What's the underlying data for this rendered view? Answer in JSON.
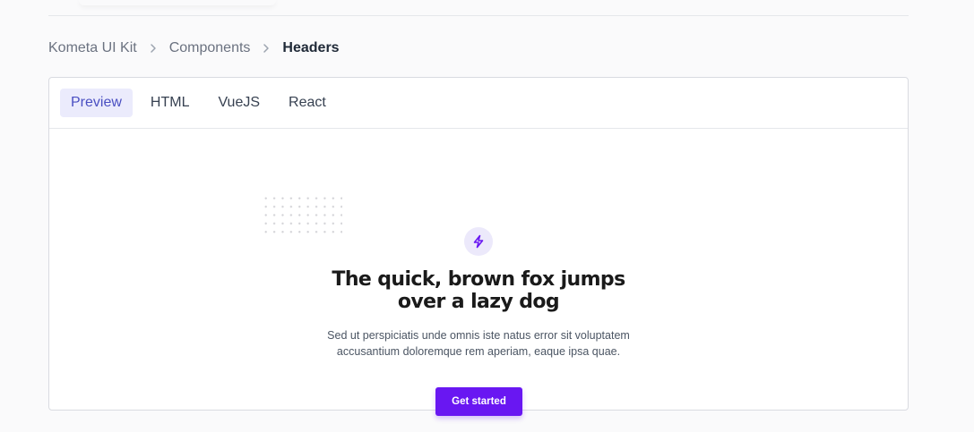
{
  "breadcrumb": {
    "items": [
      "Kometa UI Kit",
      "Components",
      "Headers"
    ]
  },
  "tabs": [
    {
      "label": "Preview",
      "active": true
    },
    {
      "label": "HTML",
      "active": false
    },
    {
      "label": "VueJS",
      "active": false
    },
    {
      "label": "React",
      "active": false
    }
  ],
  "preview": {
    "badge_icon": "lightning-bolt-icon",
    "headline_line1": "The quick, brown fox jumps",
    "headline_line2": "over a lazy dog",
    "subtext_line1": "Sed ut perspiciatis unde omnis iste natus error sit voluptatem",
    "subtext_line2": "accusantium doloremque rem aperiam, eaque ipsa quae.",
    "cta_label": "Get started"
  },
  "colors": {
    "accent": "#6917f2",
    "tab_active_bg": "#ebebfc",
    "tab_active_text": "#4a4fc2",
    "badge_bg": "#ece9fb"
  }
}
